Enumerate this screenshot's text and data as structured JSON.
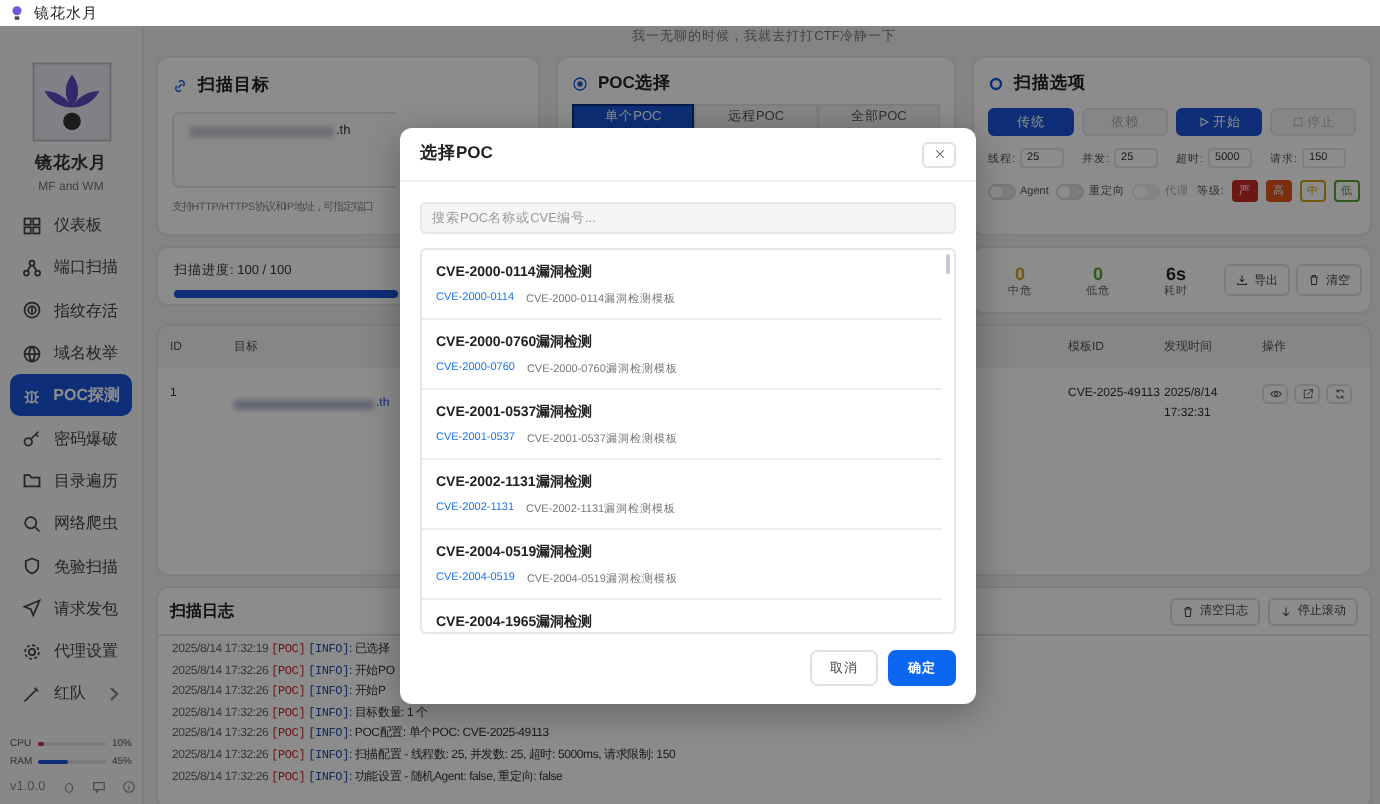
{
  "window": {
    "title": "镜花水月"
  },
  "notice": "我一无聊的时候，我就去打打CTF冷静一下",
  "sidebar": {
    "app_name": "镜花水月",
    "subtitle": "MF and WM",
    "items": [
      {
        "label": "仪表板",
        "selected": false
      },
      {
        "label": "端口扫描",
        "selected": false
      },
      {
        "label": "指纹存活",
        "selected": false
      },
      {
        "label": "域名枚举",
        "selected": false
      },
      {
        "label": "POC探测",
        "selected": true
      },
      {
        "label": "密码爆破",
        "selected": false
      },
      {
        "label": "目录遍历",
        "selected": false
      },
      {
        "label": "网络爬虫",
        "selected": false
      },
      {
        "label": "免验扫描",
        "selected": false
      },
      {
        "label": "请求发包",
        "selected": false
      },
      {
        "label": "代理设置",
        "selected": false
      },
      {
        "label": "红队",
        "selected": false,
        "expandable": true
      }
    ],
    "resources": [
      {
        "label": "CPU",
        "level": 0.1,
        "reading": "10%",
        "color": "#741a1a"
      },
      {
        "label": "RAM",
        "level": 0.45,
        "reading": "45%",
        "color": "#0e2f78"
      }
    ],
    "version": "v1.0.0"
  },
  "scan_target": {
    "title": "扫描目标",
    "value": ".th",
    "hint": "支持HTTP/HTTPS协议和IP地址，可指定端口"
  },
  "poc_selection": {
    "title": "POC选择",
    "tabs": [
      {
        "label": "单个POC",
        "selected": true
      },
      {
        "label": "远程POC",
        "selected": false
      },
      {
        "label": "全部POC",
        "selected": false
      }
    ]
  },
  "scan_options": {
    "title": "扫描选项",
    "modes": [
      {
        "label": "传统",
        "selected": true
      },
      {
        "label": "依赖",
        "selected": false
      }
    ],
    "actions": [
      {
        "label": "开始",
        "disabled": false
      },
      {
        "label": "停止",
        "disabled": true
      }
    ],
    "fields": [
      {
        "label": "线程:",
        "value": "25"
      },
      {
        "label": "并发:",
        "value": "25"
      },
      {
        "label": "超时:",
        "value": "5000"
      },
      {
        "label": "请求:",
        "value": "150"
      }
    ],
    "toggles": [
      {
        "label": "Agent",
        "on": false,
        "disabled": false
      },
      {
        "label": "重定向",
        "on": false,
        "disabled": false
      },
      {
        "label": "代理",
        "on": false,
        "disabled": true
      }
    ],
    "level_label": "等级:",
    "levels": [
      {
        "label": "严",
        "selected": true,
        "color": "#6d1616"
      },
      {
        "label": "高",
        "selected": true,
        "color": "#7b2f0f"
      },
      {
        "label": "中",
        "selected": false,
        "color": "#74580d"
      },
      {
        "label": "低",
        "selected": false,
        "color": "#31571a"
      }
    ]
  },
  "progress": {
    "label": "扫描进度: 100 / 100",
    "level": 1
  },
  "stats": {
    "items": [
      {
        "value": "0",
        "label": "中危",
        "color": "#74580d"
      },
      {
        "value": "0",
        "label": "低危",
        "color": "#31571a"
      },
      {
        "value": "6s",
        "label": "耗时",
        "color": "#131313"
      }
    ],
    "buttons": [
      "导出",
      "清空"
    ]
  },
  "results": {
    "columns": [
      "ID",
      "目标",
      "模板ID",
      "发现时间",
      "操作"
    ],
    "rows": [
      {
        "id": "1",
        "target": ".th",
        "template_id": "CVE-2025-49113",
        "time": "2025/8/14 17:32:31"
      }
    ]
  },
  "log": {
    "title": "扫描日志",
    "buttons": [
      "清空日志",
      "停止滚动"
    ],
    "lines": [
      {
        "time": "2025/8/14 17:32:19",
        "source": "[POC]",
        "level": "[INFO]",
        "message": ": 已选择"
      },
      {
        "time": "2025/8/14 17:32:26",
        "source": "[POC]",
        "level": "[INFO]",
        "message": ": 开始PO"
      },
      {
        "time": "2025/8/14 17:32:26",
        "source": "[POC]",
        "level": "[INFO]",
        "message": ": 开始P"
      },
      {
        "time": "2025/8/14 17:32:26",
        "source": "[POC]",
        "level": "[INFO]",
        "message": ": 目标数量: 1 个"
      },
      {
        "time": "2025/8/14 17:32:26",
        "source": "[POC]",
        "level": "[INFO]",
        "message": ": POC配置: 单个POC: CVE-2025-49113"
      },
      {
        "time": "2025/8/14 17:32:26",
        "source": "[POC]",
        "level": "[INFO]",
        "message": ": 扫描配置 - 线程数: 25, 并发数: 25, 超时: 5000ms, 请求限制: 150"
      },
      {
        "time": "2025/8/14 17:32:26",
        "source": "[POC]",
        "level": "[INFO]",
        "message": ": 功能设置 - 随机Agent: false, 重定向: false"
      }
    ]
  },
  "dialog": {
    "title": "选择POC",
    "search": {
      "placeholder": "搜索POC名称或CVE编号..."
    },
    "items": [
      {
        "title": "CVE-2000-0114漏洞检测",
        "id": "CVE-2000-0114",
        "description": "CVE-2000-0114漏洞检测模板"
      },
      {
        "title": "CVE-2000-0760漏洞检测",
        "id": "CVE-2000-0760",
        "description": "CVE-2000-0760漏洞检测模板"
      },
      {
        "title": "CVE-2001-0537漏洞检测",
        "id": "CVE-2001-0537",
        "description": "CVE-2001-0537漏洞检测模板"
      },
      {
        "title": "CVE-2002-1131漏洞检测",
        "id": "CVE-2002-1131",
        "description": "CVE-2002-1131漏洞检测模板"
      },
      {
        "title": "CVE-2004-0519漏洞检测",
        "id": "CVE-2004-0519",
        "description": "CVE-2004-0519漏洞检测模板"
      },
      {
        "title": "CVE-2004-1965漏洞检测"
      }
    ],
    "buttons": [
      {
        "label": "取消",
        "kind": "secondary"
      },
      {
        "label": "确定",
        "kind": "primary"
      }
    ]
  }
}
